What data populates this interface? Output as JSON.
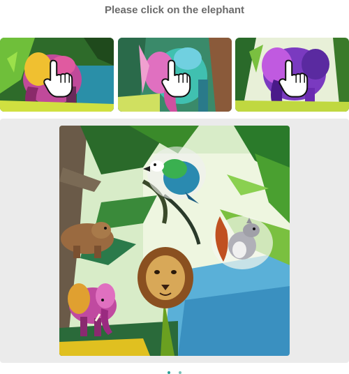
{
  "prompt": {
    "text": "Please click on the elephant"
  },
  "examples": [
    {
      "subject": "elephant",
      "icon": "pointing-hand-icon"
    },
    {
      "subject": "elephant",
      "icon": "pointing-hand-icon"
    },
    {
      "subject": "elephant",
      "icon": "pointing-hand-icon"
    }
  ],
  "scene": {
    "animals": [
      "bird",
      "squirrel",
      "bear",
      "lion",
      "elephant"
    ]
  },
  "footer": {
    "left_text": "",
    "accent_color": "#2aa198"
  },
  "colors": {
    "title": "#6b6b6b",
    "panel_background": "#ebebeb"
  }
}
